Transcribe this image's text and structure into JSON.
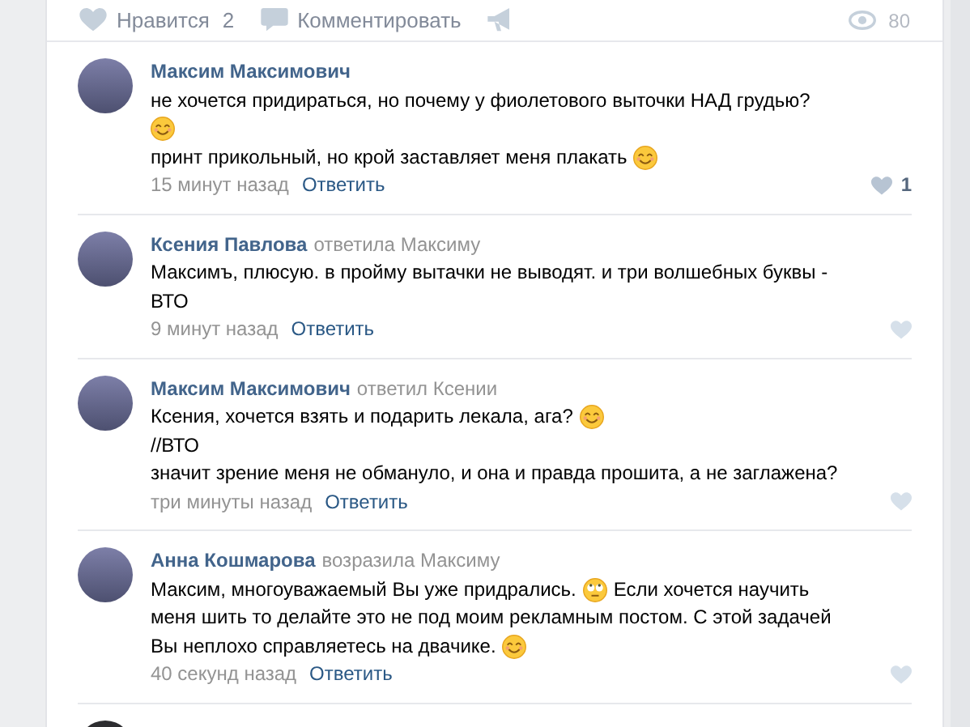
{
  "post_actions": {
    "like_label": "Нравится",
    "like_count": "2",
    "comment_label": "Комментировать",
    "views": "80"
  },
  "comments": [
    {
      "author": "Максим Максимович",
      "lines": [
        [
          {
            "kind": "text",
            "text": "не хочется придираться, но почему у фиолетового выточки НАД грудью?"
          }
        ],
        [
          {
            "kind": "smile"
          }
        ],
        [
          {
            "kind": "text",
            "text": "принт прикольный, но крой заставляет меня плакать"
          },
          {
            "kind": "smile"
          }
        ]
      ],
      "time": "15 минут назад",
      "reply_label": "Ответить",
      "likes": "1"
    },
    {
      "author": "Ксения Павлова",
      "reply_to": "ответила Максиму",
      "lines": [
        [
          {
            "kind": "text",
            "text": "Максимъ, плюсую. в пройму вытачки не выводят. и три волшебных буквы -"
          }
        ],
        [
          {
            "kind": "text",
            "text": "ВТО"
          }
        ]
      ],
      "time": "9 минут назад",
      "reply_label": "Ответить"
    },
    {
      "author": "Максим Максимович",
      "reply_to": "ответил Ксении",
      "lines": [
        [
          {
            "kind": "text",
            "text": "Ксения, хочется взять и подарить лекала, ага?"
          },
          {
            "kind": "smile"
          }
        ],
        [
          {
            "kind": "text",
            "text": "//ВТО"
          }
        ],
        [
          {
            "kind": "text",
            "text": "значит зрение меня не обмануло, и она и правда прошита, а не заглажена?"
          }
        ]
      ],
      "time": "три минуты назад",
      "reply_label": "Ответить"
    },
    {
      "author": "Анна Кошмарова",
      "reply_to": "возразила Максиму",
      "lines": [
        [
          {
            "kind": "text",
            "text": "Максим, многоуважаемый Вы уже придрались."
          },
          {
            "kind": "rolling-eyes"
          },
          {
            "kind": "text",
            "text": "Если хочется научить"
          }
        ],
        [
          {
            "kind": "text",
            "text": "меня шить то делайте это не под моим рекламным постом. С этой задачей"
          }
        ],
        [
          {
            "kind": "text",
            "text": "Вы неплохо справляетесь на двачике."
          },
          {
            "kind": "smile"
          }
        ]
      ],
      "time": "40 секунд назад",
      "reply_label": "Ответить"
    }
  ]
}
